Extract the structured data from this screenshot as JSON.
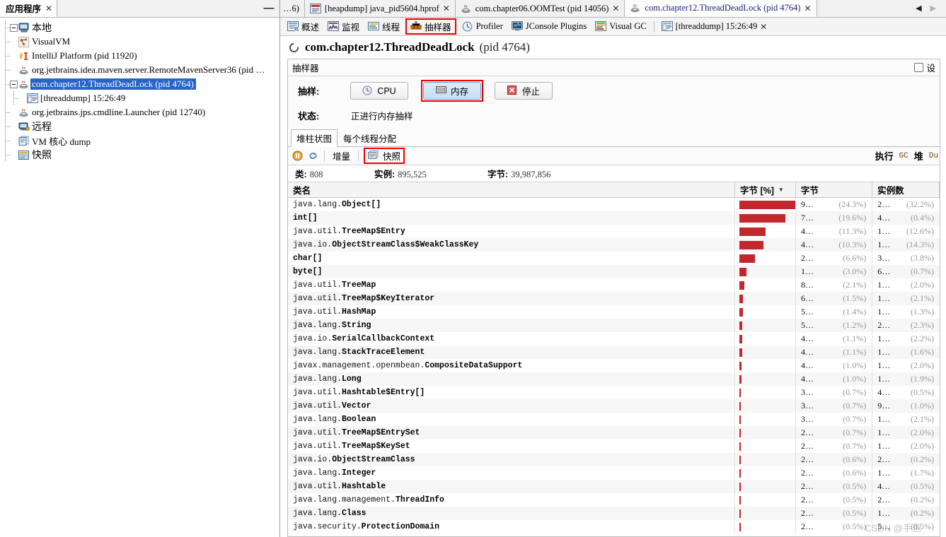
{
  "left_panel": {
    "tab": {
      "label": "应用程序",
      "close": "✕",
      "icon": "applications-icon"
    },
    "minimize": "—",
    "tree": [
      {
        "label": "本地",
        "icon": "computer-icon",
        "depth": 0,
        "expanded": true,
        "selected": false,
        "size": "big"
      },
      {
        "label": "VisualVM",
        "icon": "visualvm-icon",
        "depth": 1,
        "selected": false
      },
      {
        "label": "IntelliJ Platform (pid 11920)",
        "icon": "intellij-icon",
        "depth": 1,
        "selected": false
      },
      {
        "label": "org.jetbrains.idea.maven.server.RemoteMavenServer36 (pid …",
        "icon": "java-icon",
        "depth": 1,
        "selected": false
      },
      {
        "label": "com.chapter12.ThreadDeadLock (pid 4764)",
        "icon": "java-icon",
        "depth": 1,
        "expanded": true,
        "selected": true
      },
      {
        "label": "[threaddump] 15:26:49",
        "icon": "threaddump-icon",
        "depth": 2,
        "selected": false
      },
      {
        "label": "org.jetbrains.jps.cmdline.Launcher (pid 12740)",
        "icon": "java-icon",
        "depth": 1,
        "selected": false
      },
      {
        "label": "远程",
        "icon": "remote-icon",
        "depth": 0,
        "selected": false,
        "size": "big"
      },
      {
        "label": "VM 核心 dump",
        "icon": "coredump-icon",
        "depth": 0,
        "selected": false
      },
      {
        "label": "快照",
        "icon": "snapshot-icon",
        "depth": 0,
        "selected": false,
        "size": "big"
      }
    ]
  },
  "top_tabs": [
    {
      "label": "…6)",
      "icon": "none",
      "close": "",
      "active": false,
      "truncated": true
    },
    {
      "label": "[heapdump] java_pid5604.hprof",
      "icon": "heapdump-icon",
      "close": "✕",
      "active": false
    },
    {
      "label": "com.chapter06.OOMTest (pid 14056)",
      "icon": "java-icon",
      "close": "✕",
      "active": false
    },
    {
      "label": "com.chapter12.ThreadDeadLock (pid 4764)",
      "icon": "java-icon",
      "close": "✕",
      "active": true
    }
  ],
  "tab_scroll": {
    "left": "◀",
    "right": "▶"
  },
  "sub_tabs": [
    {
      "label": "概述",
      "icon": "overview-icon",
      "highlight": false
    },
    {
      "label": "监视",
      "icon": "monitor-icon",
      "highlight": false
    },
    {
      "label": "线程",
      "icon": "threads-icon",
      "highlight": false
    },
    {
      "label": "抽样器",
      "icon": "sampler-icon",
      "highlight": true
    },
    {
      "label": "Profiler",
      "icon": "profiler-icon",
      "highlight": false
    },
    {
      "label": "JConsole Plugins",
      "icon": "jconsole-icon",
      "highlight": false
    },
    {
      "label": "Visual GC",
      "icon": "visualgc-icon",
      "highlight": false
    },
    {
      "label": "[threaddump] 15:26:49",
      "icon": "threaddump-icon",
      "highlight": false,
      "close": "✕"
    }
  ],
  "main": {
    "app_title": "com.chapter12.ThreadDeadLock",
    "app_pid": "(pid 4764)",
    "sampler_panel_title": "抽样器",
    "settings_label": "设",
    "sampling_label": "抽样:",
    "buttons": {
      "cpu": "CPU",
      "memory": "内存",
      "stop": "停止"
    },
    "status_label": "状态:",
    "status_value": "正进行内存抽样",
    "content_tabs": [
      {
        "label": "堆柱状图",
        "active": true
      },
      {
        "label": "每个线程分配",
        "active": false
      }
    ],
    "toolbar": {
      "pause_icon": "pause-icon",
      "refresh_icon": "refresh-icon",
      "delta_label": "增量",
      "snapshot_label": "快照",
      "right_run": "执行",
      "right_gc": "GC",
      "right_heap": "堆",
      "right_dump": "Du"
    },
    "stats": [
      {
        "key": "类:",
        "value": "808"
      },
      {
        "key": "实例:",
        "value": "895,525"
      },
      {
        "key": "字节:",
        "value": "39,987,856"
      }
    ]
  },
  "watermark": "CSDN @手爸",
  "chart_data": {
    "type": "table",
    "title": "堆柱状图",
    "columns": [
      "类名",
      "字节 [%]",
      "字节",
      "实例数"
    ],
    "sorted_by": "字节 [%]",
    "sort_dir": "desc",
    "bar_color": "#c1272d",
    "rows": [
      {
        "pkg": "java.lang.",
        "cls": "Object[]",
        "pct": 24.3,
        "bytes": "9…",
        "bytes_pct": "(24.3%)",
        "inst": "2…",
        "inst_pct": "(32.2%)"
      },
      {
        "pkg": "",
        "cls": "int[]",
        "pct": 19.6,
        "bytes": "7…",
        "bytes_pct": "(19.6%)",
        "inst": "4…",
        "inst_pct": "(0.4%)"
      },
      {
        "pkg": "java.util.",
        "cls": "TreeMap$Entry",
        "pct": 11.3,
        "bytes": "4…",
        "bytes_pct": "(11.3%)",
        "inst": "1…",
        "inst_pct": "(12.6%)"
      },
      {
        "pkg": "java.io.",
        "cls": "ObjectStreamClass$WeakClassKey",
        "pct": 10.3,
        "bytes": "4…",
        "bytes_pct": "(10.3%)",
        "inst": "1…",
        "inst_pct": "(14.3%)"
      },
      {
        "pkg": "",
        "cls": "char[]",
        "pct": 6.6,
        "bytes": "2…",
        "bytes_pct": "(6.6%)",
        "inst": "3…",
        "inst_pct": "(3.8%)"
      },
      {
        "pkg": "",
        "cls": "byte[]",
        "pct": 3.0,
        "bytes": "1…",
        "bytes_pct": "(3.0%)",
        "inst": "6…",
        "inst_pct": "(0.7%)"
      },
      {
        "pkg": "java.util.",
        "cls": "TreeMap",
        "pct": 2.1,
        "bytes": "8…",
        "bytes_pct": "(2.1%)",
        "inst": "1…",
        "inst_pct": "(2.0%)"
      },
      {
        "pkg": "java.util.",
        "cls": "TreeMap$KeyIterator",
        "pct": 1.5,
        "bytes": "6…",
        "bytes_pct": "(1.5%)",
        "inst": "1…",
        "inst_pct": "(2.1%)"
      },
      {
        "pkg": "java.util.",
        "cls": "HashMap",
        "pct": 1.4,
        "bytes": "5…",
        "bytes_pct": "(1.4%)",
        "inst": "1…",
        "inst_pct": "(1.3%)"
      },
      {
        "pkg": "java.lang.",
        "cls": "String",
        "pct": 1.2,
        "bytes": "5…",
        "bytes_pct": "(1.2%)",
        "inst": "2…",
        "inst_pct": "(2.3%)"
      },
      {
        "pkg": "java.io.",
        "cls": "SerialCallbackContext",
        "pct": 1.1,
        "bytes": "4…",
        "bytes_pct": "(1.1%)",
        "inst": "1…",
        "inst_pct": "(2.2%)"
      },
      {
        "pkg": "java.lang.",
        "cls": "StackTraceElement",
        "pct": 1.1,
        "bytes": "4…",
        "bytes_pct": "(1.1%)",
        "inst": "1…",
        "inst_pct": "(1.6%)"
      },
      {
        "pkg": "javax.management.openmbean.",
        "cls": "CompositeDataSupport",
        "pct": 1.0,
        "bytes": "4…",
        "bytes_pct": "(1.0%)",
        "inst": "1…",
        "inst_pct": "(2.0%)"
      },
      {
        "pkg": "java.lang.",
        "cls": "Long",
        "pct": 1.0,
        "bytes": "4…",
        "bytes_pct": "(1.0%)",
        "inst": "1…",
        "inst_pct": "(1.9%)"
      },
      {
        "pkg": "java.util.",
        "cls": "Hashtable$Entry[]",
        "pct": 0.7,
        "bytes": "3…",
        "bytes_pct": "(0.7%)",
        "inst": "4…",
        "inst_pct": "(0.5%)"
      },
      {
        "pkg": "java.util.",
        "cls": "Vector",
        "pct": 0.7,
        "bytes": "3…",
        "bytes_pct": "(0.7%)",
        "inst": "9…",
        "inst_pct": "(1.0%)"
      },
      {
        "pkg": "java.lang.",
        "cls": "Boolean",
        "pct": 0.7,
        "bytes": "3…",
        "bytes_pct": "(0.7%)",
        "inst": "1…",
        "inst_pct": "(2.1%)"
      },
      {
        "pkg": "java.util.",
        "cls": "TreeMap$EntrySet",
        "pct": 0.7,
        "bytes": "2…",
        "bytes_pct": "(0.7%)",
        "inst": "1…",
        "inst_pct": "(2.0%)"
      },
      {
        "pkg": "java.util.",
        "cls": "TreeMap$KeySet",
        "pct": 0.7,
        "bytes": "2…",
        "bytes_pct": "(0.7%)",
        "inst": "1…",
        "inst_pct": "(2.0%)"
      },
      {
        "pkg": "java.io.",
        "cls": "ObjectStreamClass",
        "pct": 0.6,
        "bytes": "2…",
        "bytes_pct": "(0.6%)",
        "inst": "2…",
        "inst_pct": "(0.2%)"
      },
      {
        "pkg": "java.lang.",
        "cls": "Integer",
        "pct": 0.6,
        "bytes": "2…",
        "bytes_pct": "(0.6%)",
        "inst": "1…",
        "inst_pct": "(1.7%)"
      },
      {
        "pkg": "java.util.",
        "cls": "Hashtable",
        "pct": 0.5,
        "bytes": "2…",
        "bytes_pct": "(0.5%)",
        "inst": "4…",
        "inst_pct": "(0.5%)"
      },
      {
        "pkg": "java.lang.management.",
        "cls": "ThreadInfo",
        "pct": 0.5,
        "bytes": "2…",
        "bytes_pct": "(0.5%)",
        "inst": "2…",
        "inst_pct": "(0.2%)"
      },
      {
        "pkg": "java.lang.",
        "cls": "Class",
        "pct": 0.5,
        "bytes": "2…",
        "bytes_pct": "(0.5%)",
        "inst": "1…",
        "inst_pct": "(0.2%)"
      },
      {
        "pkg": "java.security.",
        "cls": "ProtectionDomain",
        "pct": 0.5,
        "bytes": "2…",
        "bytes_pct": "(0.5%)",
        "inst": "5…",
        "inst_pct": "(0.5%)"
      }
    ]
  }
}
